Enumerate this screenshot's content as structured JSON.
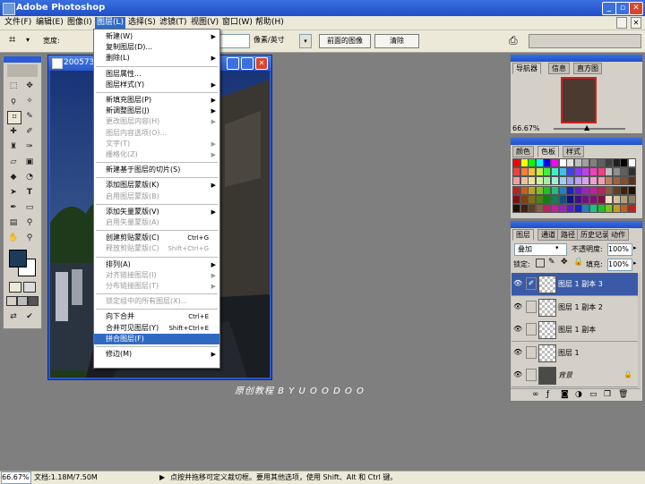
{
  "app": {
    "title": "Adobe Photoshop"
  },
  "menubar": [
    "文件(F)",
    "编辑(E)",
    "图像(I)",
    "图层(L)",
    "选择(S)",
    "滤镜(T)",
    "视图(V)",
    "窗口(W)",
    "帮助(H)"
  ],
  "options": {
    "width_label": "宽度:",
    "unit_select": "像素/英寸",
    "front_image_button": "前面的图像",
    "clear_button": "清除"
  },
  "document": {
    "title": "200573",
    "zoom": "66.67%",
    "doc_size": "文档:1.18M/7.50M"
  },
  "layer_menu": [
    {
      "label": "新建(W)",
      "submenu": true
    },
    {
      "label": "复制图层(D)..."
    },
    {
      "label": "删除(L)",
      "submenu": true
    },
    {
      "sep": true
    },
    {
      "label": "图层属性..."
    },
    {
      "label": "图层样式(Y)",
      "submenu": true
    },
    {
      "sep": true
    },
    {
      "label": "新填充图层(P)",
      "submenu": true
    },
    {
      "label": "新调整图层(J)",
      "submenu": true
    },
    {
      "label": "更改图层内容(H)",
      "submenu": true,
      "disabled": true
    },
    {
      "label": "图层内容选项(O)...",
      "disabled": true
    },
    {
      "label": "文字(T)",
      "submenu": true,
      "disabled": true
    },
    {
      "label": "栅格化(Z)",
      "submenu": true,
      "disabled": true
    },
    {
      "sep": true
    },
    {
      "label": "新建基于图层的切片(S)"
    },
    {
      "sep": true
    },
    {
      "label": "添加图层蒙版(K)",
      "submenu": true
    },
    {
      "label": "启用图层蒙版(B)",
      "disabled": true
    },
    {
      "sep": true
    },
    {
      "label": "添加矢量蒙版(V)",
      "submenu": true
    },
    {
      "label": "启用矢量蒙版(A)",
      "disabled": true
    },
    {
      "sep": true
    },
    {
      "label": "创建剪贴蒙版(C)",
      "shortcut": "Ctrl+G"
    },
    {
      "label": "释放剪贴蒙版(C)",
      "shortcut": "Shift+Ctrl+G",
      "disabled": true
    },
    {
      "sep": true
    },
    {
      "label": "排列(A)",
      "submenu": true
    },
    {
      "label": "对齐链接图层(I)",
      "submenu": true,
      "disabled": true
    },
    {
      "label": "分布链接图层(T)",
      "submenu": true,
      "disabled": true
    },
    {
      "sep": true
    },
    {
      "label": "锁定组中的所有图层(X)...",
      "disabled": true
    },
    {
      "sep": true
    },
    {
      "label": "向下合并",
      "shortcut": "Ctrl+E"
    },
    {
      "label": "合并可见图层(Y)",
      "shortcut": "Shift+Ctrl+E"
    },
    {
      "label": "拼合图层(F)",
      "highlighted": true
    },
    {
      "sep": true
    },
    {
      "label": "修边(M)",
      "submenu": true
    }
  ],
  "navigator": {
    "tabs": [
      "导航器",
      "信息",
      "直方图"
    ],
    "zoom": "66.67%"
  },
  "swatches": {
    "tabs": [
      "颜色",
      "色板",
      "样式"
    ]
  },
  "layers": {
    "tabs": [
      "图层",
      "通道",
      "路径",
      "历史记录",
      "动作"
    ],
    "blend_mode": "叠加",
    "opacity_label": "不透明度:",
    "opacity": "100%",
    "lock_label": "锁定:",
    "fill_label": "填充:",
    "fill": "100%",
    "items": [
      {
        "name": "图层 1 副本 3",
        "selected": true
      },
      {
        "name": "图层 1 副本 2"
      },
      {
        "name": "图层 1 副本"
      },
      {
        "name": "图层 1"
      },
      {
        "name": "背景",
        "background": true
      }
    ]
  },
  "status": {
    "hint": "点按并拖移可定义裁切框。要用其他选项，使用 Shift、Alt 和 Ctrl 键。"
  },
  "watermark": "原创教程    B Y   U O O D O O",
  "colors": {
    "titlebar": "#2a5ad6",
    "highlight": "#316ac5",
    "panel": "#d4d0c8"
  }
}
